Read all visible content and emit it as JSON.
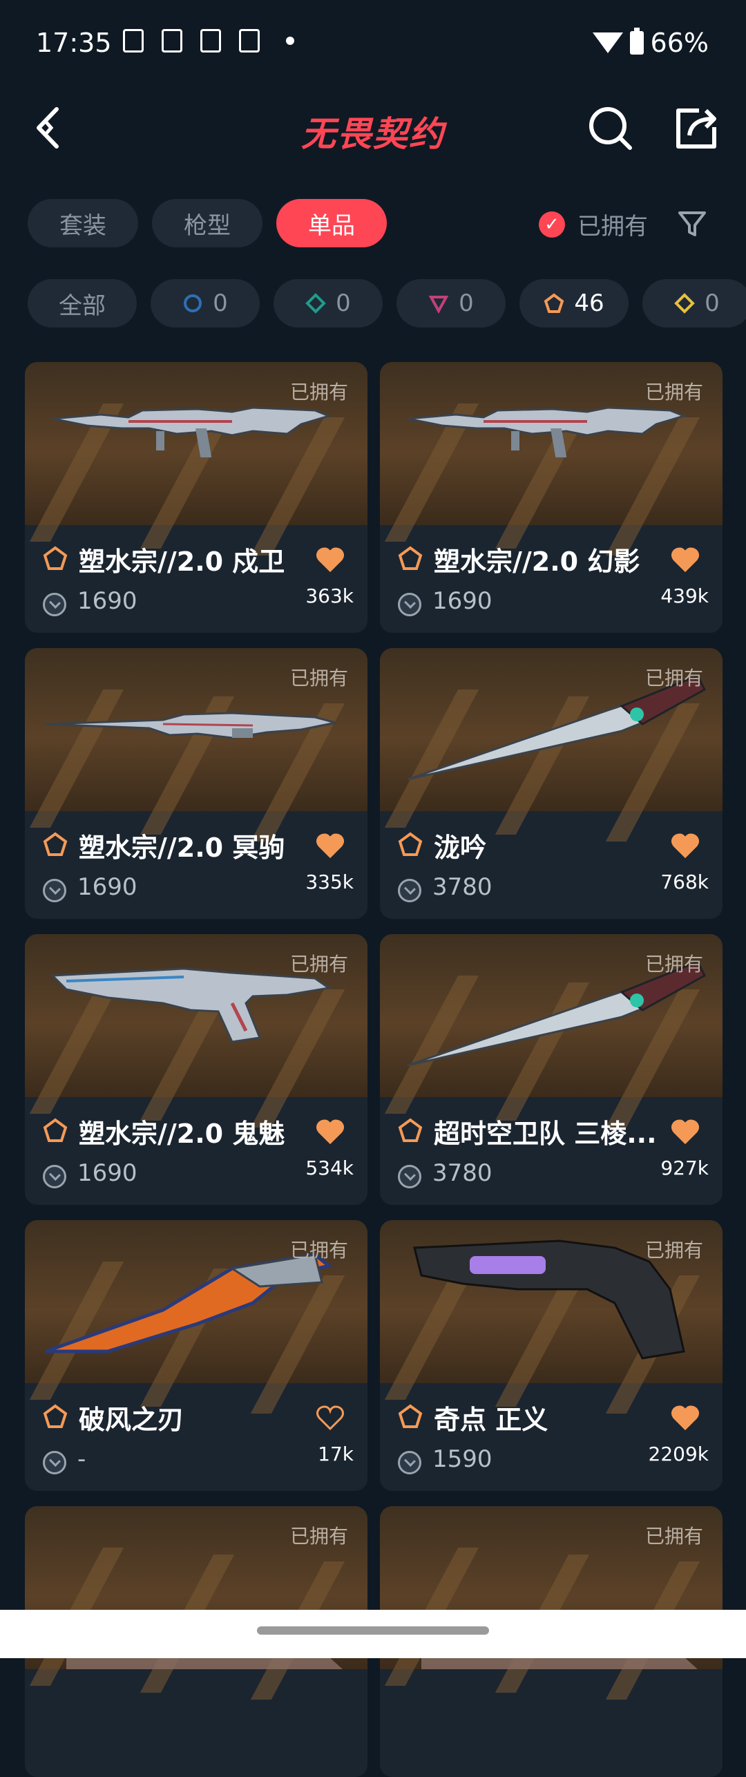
{
  "status": {
    "time": "17:35",
    "battery": "66%"
  },
  "header": {
    "logo": "无畏契约"
  },
  "tabs": [
    {
      "label": "套装"
    },
    {
      "label": "枪型"
    },
    {
      "label": "单品"
    }
  ],
  "owned_filter": {
    "label": "已拥有"
  },
  "tiers": [
    {
      "label": "全部"
    },
    {
      "count": "0",
      "color": "#2d6fb5",
      "shape": "circle"
    },
    {
      "count": "0",
      "color": "#1f9c8a",
      "shape": "diamond"
    },
    {
      "count": "0",
      "color": "#c2417a",
      "shape": "triangle"
    },
    {
      "count": "46",
      "color": "#f59a56",
      "shape": "pentagon"
    },
    {
      "count": "0",
      "color": "#e8c040",
      "shape": "diamond"
    }
  ],
  "items": [
    {
      "owned": "已拥有",
      "name": "塑水宗//2.0 戍卫",
      "price": "1690",
      "likes": "363k",
      "liked": true,
      "weapon": "rifle"
    },
    {
      "owned": "已拥有",
      "name": "塑水宗//2.0 幻影",
      "price": "1690",
      "likes": "439k",
      "liked": true,
      "weapon": "rifle"
    },
    {
      "owned": "已拥有",
      "name": "塑水宗//2.0 冥驹",
      "price": "1690",
      "likes": "335k",
      "liked": true,
      "weapon": "sniper"
    },
    {
      "owned": "已拥有",
      "name": "泷吟",
      "price": "3780",
      "likes": "768k",
      "liked": true,
      "weapon": "knife"
    },
    {
      "owned": "已拥有",
      "name": "塑水宗//2.0 鬼魅",
      "price": "1690",
      "likes": "534k",
      "liked": true,
      "weapon": "pistol"
    },
    {
      "owned": "已拥有",
      "name": "超时空卫队 三棱...",
      "price": "3780",
      "likes": "927k",
      "liked": true,
      "weapon": "knife"
    },
    {
      "owned": "已拥有",
      "name": "破风之刃",
      "price": "-",
      "likes": "17k",
      "liked": false,
      "weapon": "blade"
    },
    {
      "owned": "已拥有",
      "name": "奇点 正义",
      "price": "1590",
      "likes": "2209k",
      "liked": true,
      "weapon": "revolver"
    },
    {
      "owned": "已拥有",
      "name": "",
      "price": "",
      "likes": "",
      "liked": false,
      "weapon": "partial"
    },
    {
      "owned": "已拥有",
      "name": "",
      "price": "",
      "likes": "",
      "liked": false,
      "weapon": "partial"
    }
  ],
  "colors": {
    "accent": "#ff4655",
    "heart": "#f59a56",
    "tier_icon": "#f59a56"
  }
}
